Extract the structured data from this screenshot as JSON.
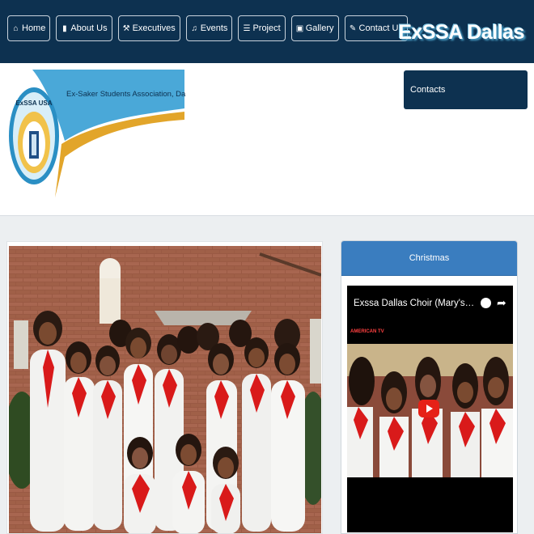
{
  "nav": {
    "items": [
      {
        "label": "Home",
        "icon": "home-icon",
        "glyph": "⌂"
      },
      {
        "label": "About Us",
        "icon": "book-icon",
        "glyph": "▮"
      },
      {
        "label": "Executives",
        "icon": "gavel-icon",
        "glyph": "⚒"
      },
      {
        "label": "Events",
        "icon": "music-icon",
        "glyph": "♫"
      },
      {
        "label": "Project",
        "icon": "list-icon",
        "glyph": "☰"
      },
      {
        "label": "Gallery",
        "icon": "picture-icon",
        "glyph": "▣"
      },
      {
        "label": "Contact Us",
        "icon": "edit-icon",
        "glyph": "✎"
      }
    ]
  },
  "brand": {
    "title": "ExSSA Dallas"
  },
  "logo": {
    "tagline": "Ex-Saker Students Association, Dallas USA.",
    "emblem_text": "ExSSA USA"
  },
  "contacts": {
    "label": "Contacts"
  },
  "side": {
    "heading": "Christmas",
    "video_title": "Exssa Dallas Choir (Mary's Boy Child) ...",
    "channel": "AMERICAN TV"
  },
  "colors": {
    "navy": "#0d3150",
    "panel_blue": "#3a7dbf",
    "accent_gold": "#e2a52a",
    "sky_blue": "#4aa8d8"
  }
}
